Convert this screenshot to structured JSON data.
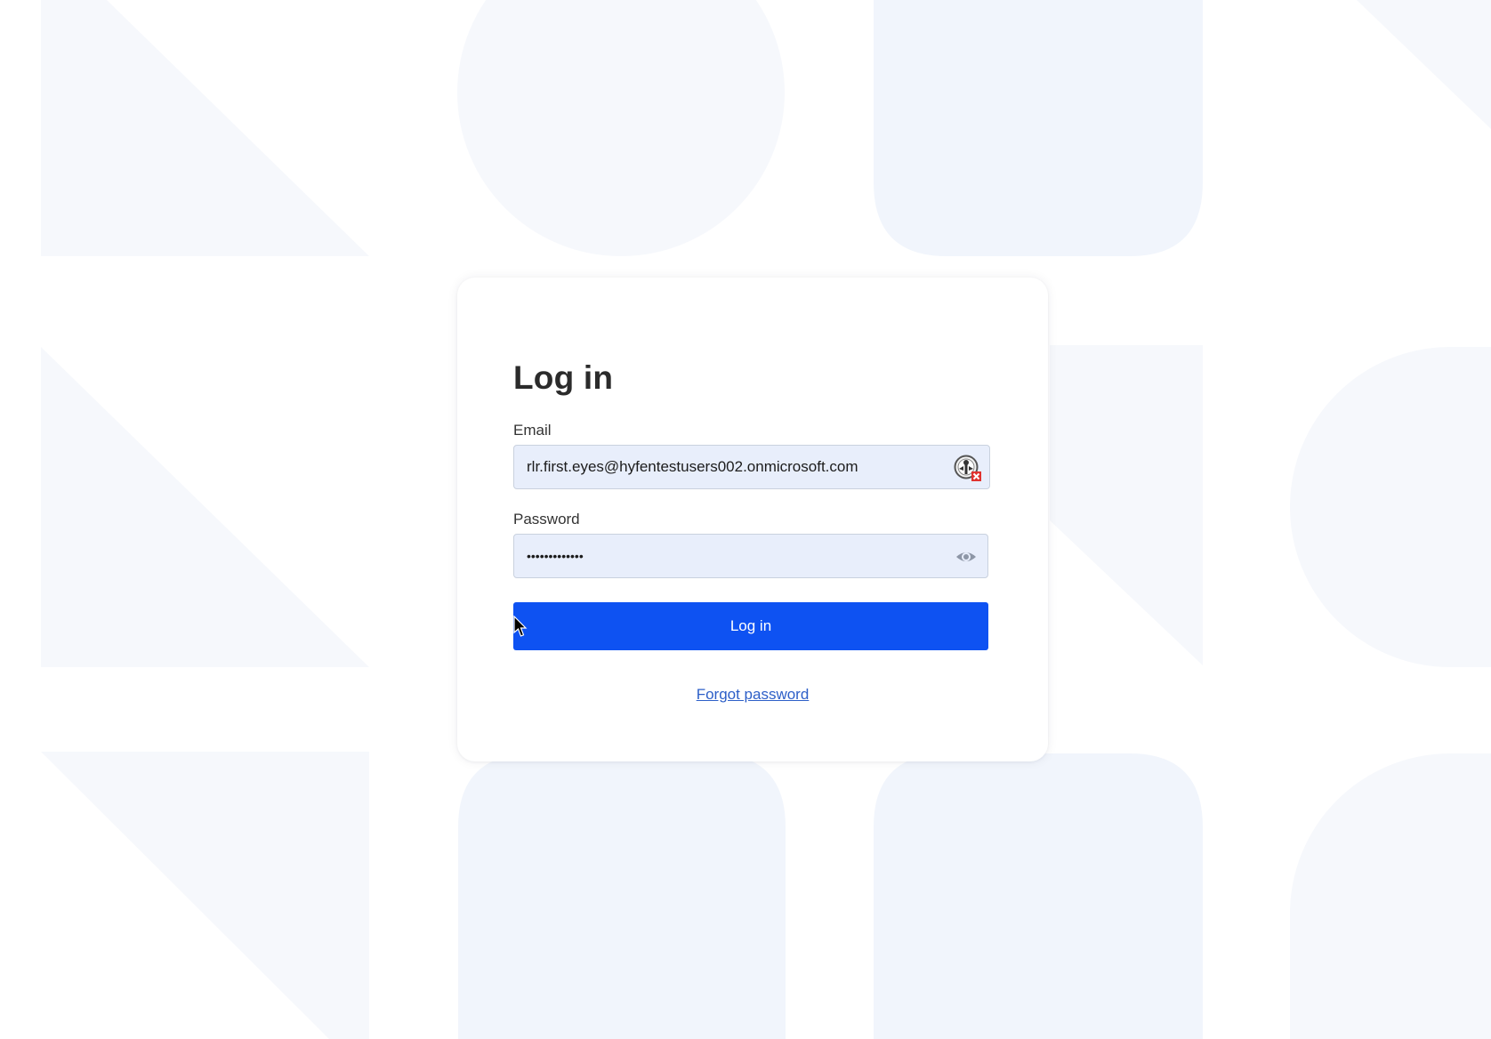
{
  "login": {
    "title": "Log in",
    "email_label": "Email",
    "email_value": "rlr.first.eyes@hyfentestusers002.onmicrosoft.com",
    "password_label": "Password",
    "password_value": "•••••••••••••",
    "submit_label": "Log in",
    "forgot_label": "Forgot password"
  },
  "icons": {
    "email_extension": "password-manager-extension-icon",
    "password_toggle": "eye-icon",
    "pointer": "mouse-cursor-icon"
  },
  "colors": {
    "primary_button": "#0e52f2",
    "link": "#2d5fc8",
    "field_background": "#e8eefb",
    "page_background": "#ffffff",
    "decor_shape": "#f4f7fc"
  }
}
